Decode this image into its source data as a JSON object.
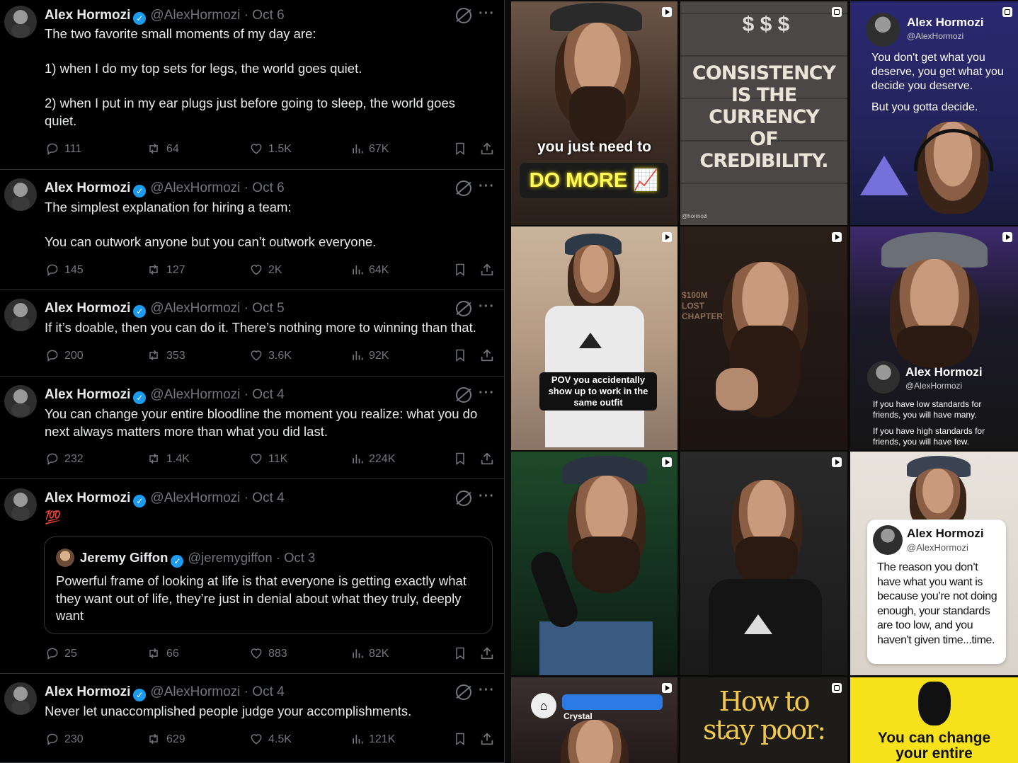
{
  "feed": {
    "author_name": "Alex Hormozi",
    "author_handle": "@AlexHormozi",
    "tweets": [
      {
        "date": "Oct 6",
        "body": [
          "The two favorite small moments of my day are:",
          "",
          "1) when I do my top sets for legs, the world goes quiet.",
          "",
          "2) when I put in my ear plugs just before going to sleep, the world goes quiet."
        ],
        "replies": "111",
        "reposts": "64",
        "likes": "1.5K",
        "views": "67K"
      },
      {
        "date": "Oct 6",
        "body": [
          "The simplest explanation for hiring a team:",
          "",
          "You can outwork anyone but you can’t outwork everyone."
        ],
        "replies": "145",
        "reposts": "127",
        "likes": "2K",
        "views": "64K"
      },
      {
        "date": "Oct 5",
        "body": [
          "If it’s doable, then you can do it. There’s nothing more to winning than that."
        ],
        "replies": "200",
        "reposts": "353",
        "likes": "3.6K",
        "views": "92K"
      },
      {
        "date": "Oct 4",
        "body": [
          "You can change your entire bloodline the moment you realize: what you do next always matters more than what you did last."
        ],
        "replies": "232",
        "reposts": "1.4K",
        "likes": "11K",
        "views": "224K"
      },
      {
        "date": "Oct 4",
        "body": [
          "💯"
        ],
        "quote": {
          "name": "Jeremy Giffon",
          "handle": "@jeremygiffon",
          "date": "Oct 3",
          "body": "Powerful frame of looking at life is that everyone is getting exactly what they want out of life, they’re just in denial about what they truly, deeply want"
        },
        "replies": "25",
        "reposts": "66",
        "likes": "883",
        "views": "82K"
      },
      {
        "date": "Oct 4",
        "body": [
          "Never let unaccomplished people judge your accomplishments."
        ],
        "replies": "230",
        "reposts": "629",
        "likes": "4.5K",
        "views": "121K"
      }
    ]
  },
  "grid": {
    "tile1": {
      "line1": "you just need to",
      "line2": "DO MORE 📈"
    },
    "tile2": {
      "lines": [
        "CONSISTENCY",
        "IS THE",
        "CURRENCY",
        "OF",
        "CREDIBILITY."
      ],
      "small": "@hormozi"
    },
    "tile3": {
      "name": "Alex Hormozi",
      "handle": "@AlexHormozi",
      "text1": "You don't get what you deserve, you get what you decide you deserve.",
      "text2": "But you gotta decide."
    },
    "tile4": {
      "caption": "POV you accidentally show up to work in the same outfit"
    },
    "tile5": {
      "sign": "$100M LOST CHAPTERS"
    },
    "tile6": {
      "name": "Alex Hormozi",
      "handle": "@AlexHormozi",
      "text1": "If you have low standards for friends, you will have many.",
      "text2": "If you have high standards for friends, you will have few."
    },
    "tile9": {
      "name": "Alex Hormozi",
      "handle": "@AlexHormozi",
      "text": "The reason you don’t have what you want is because you’re not doing enough, your standards are too low, and you haven't given time...time."
    },
    "tile10": {
      "label": "Crystal"
    },
    "tile11": {
      "line1": "How to",
      "line2": "stay poor:"
    },
    "tile12": {
      "line1": "You can change",
      "line2": "your entire"
    }
  },
  "colors": {
    "verified": "#1d9bf0",
    "text": "#e7e9ea",
    "muted": "#71767b",
    "border": "#2f3336",
    "yellow_tile": "#f7e21c"
  }
}
